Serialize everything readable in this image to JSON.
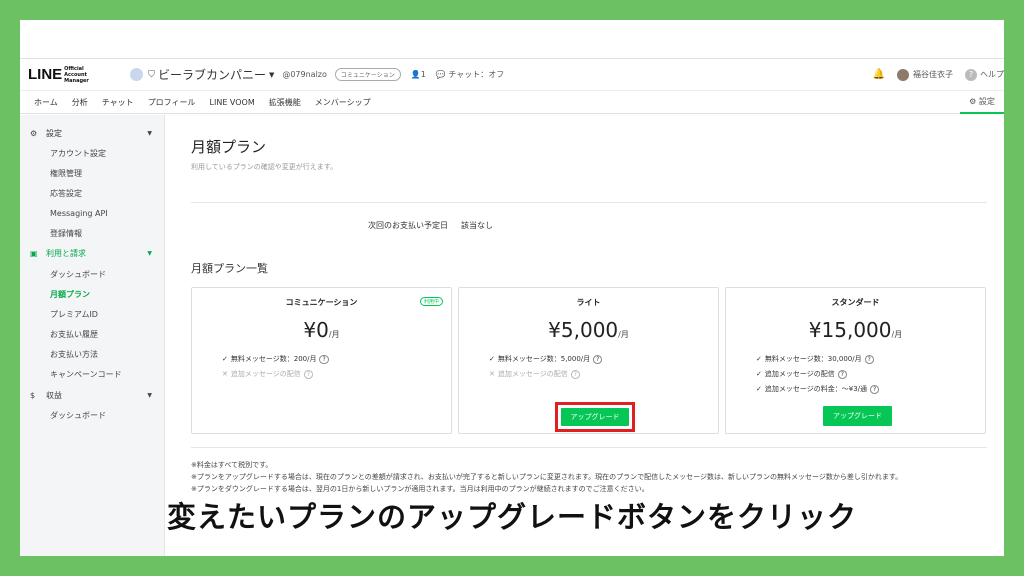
{
  "header": {
    "logo": "LINE",
    "logo_sub": "Official Account Manager",
    "account_name": "ビーラブカンパニー",
    "account_id": "@079nalzo",
    "plan_pill": "コミュニケーション",
    "friends_count": "1",
    "chat_status": "チャット：オフ",
    "user_name": "福谷佳衣子",
    "help_label": "ヘルプ"
  },
  "tabs": [
    "ホーム",
    "分析",
    "チャット",
    "プロフィール",
    "LINE VOOM",
    "拡張機能",
    "メンバーシップ"
  ],
  "settings_tab": "設定",
  "sidebar": {
    "groups": [
      {
        "label": "設定",
        "items": [
          "アカウント設定",
          "権限管理",
          "応答設定",
          "Messaging API",
          "登録情報"
        ]
      },
      {
        "label": "利用と請求",
        "items": [
          "ダッシュボード",
          "月額プラン",
          "プレミアムID",
          "お支払い履歴",
          "お支払い方法",
          "キャンペーンコード"
        ]
      },
      {
        "label": "収益",
        "items": [
          "ダッシュボード"
        ]
      }
    ]
  },
  "main": {
    "title": "月額プラン",
    "subtitle": "利用しているプランの確認や変更が行えます。",
    "next_payment_label": "次回のお支払い予定日",
    "next_payment_value": "該当なし",
    "list_title": "月額プラン一覧",
    "plans": [
      {
        "name": "コミュニケーション",
        "badge": "利用中",
        "price": "¥0",
        "unit": "/月",
        "features": [
          {
            "mark": "✓",
            "text": "無料メッセージ数：200/月"
          },
          {
            "mark": "✕",
            "text": "追加メッセージの配信"
          }
        ]
      },
      {
        "name": "ライト",
        "price": "¥5,000",
        "unit": "/月",
        "features": [
          {
            "mark": "✓",
            "text": "無料メッセージ数：5,000/月"
          },
          {
            "mark": "✕",
            "text": "追加メッセージの配信"
          }
        ],
        "button": "アップグレード"
      },
      {
        "name": "スタンダード",
        "price": "¥15,000",
        "unit": "/月",
        "features": [
          {
            "mark": "✓",
            "text": "無料メッセージ数：30,000/月"
          },
          {
            "mark": "✓",
            "text": "追加メッセージの配信"
          },
          {
            "mark": "✓",
            "text": "追加メッセージの料金：～¥3/通"
          }
        ],
        "button": "アップグレード"
      }
    ],
    "notes": [
      "※料金はすべて税別です。",
      "※プランをアップグレードする場合は、現在のプランとの差額が請求され、お支払いが完了すると新しいプランに変更されます。現在のプランで配信したメッセージ数は、新しいプランの無料メッセージ数から差し引かれます。",
      "※プランをダウングレードする場合は、翌月の1日から新しいプランが適用されます。当月は利用中のプランが継続されますのでご注意ください。"
    ]
  },
  "overlay_caption": "変えたいプランのアップグレードボタンをクリック",
  "colors": {
    "accent": "#06c755",
    "highlight": "#e02020",
    "background": "#6cc162"
  }
}
